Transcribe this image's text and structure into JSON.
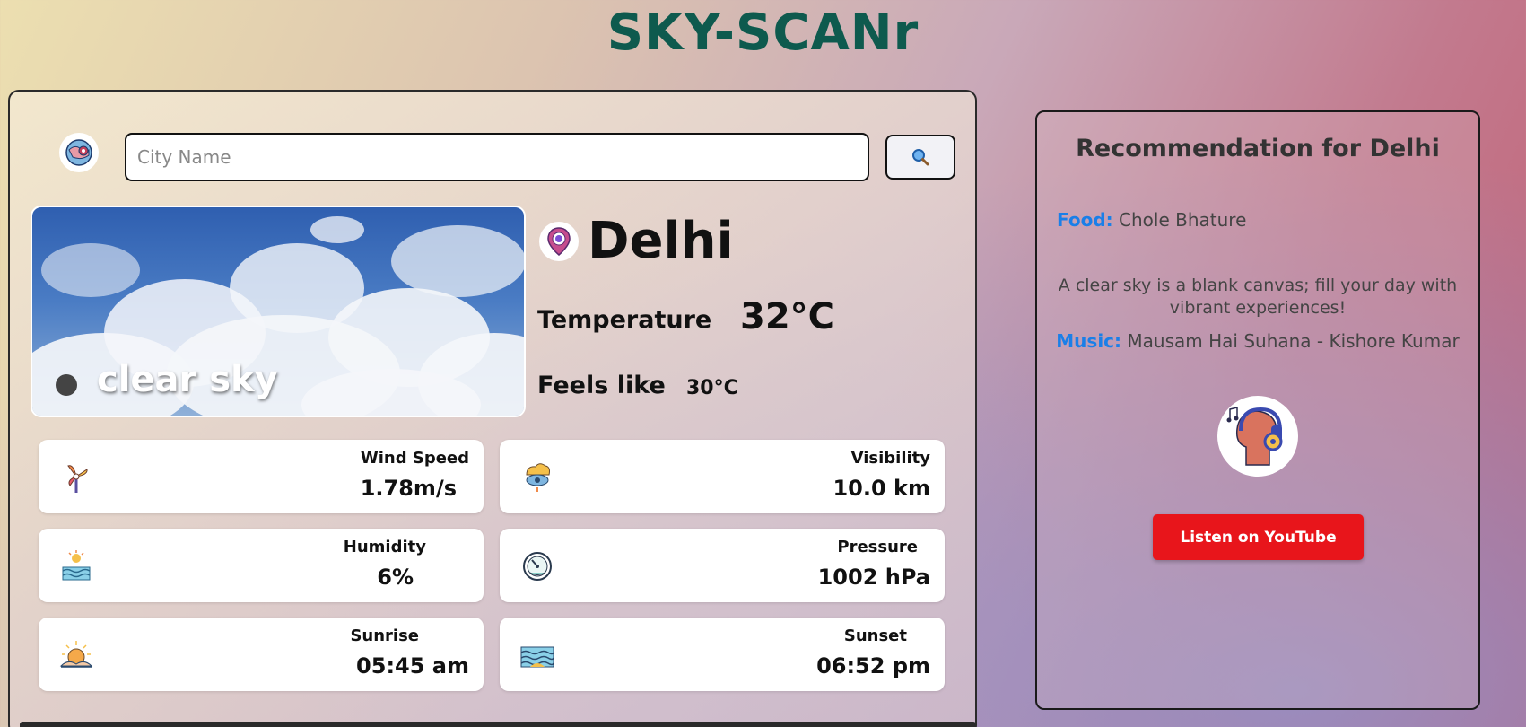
{
  "app": {
    "title": "SKY-SCANr"
  },
  "search": {
    "placeholder": "City Name",
    "value": ""
  },
  "current": {
    "description": "clear sky",
    "city": "Delhi",
    "temperature_label": "Temperature",
    "temperature_value": "32°C",
    "feels_like_label": "Feels like",
    "feels_like_value": "30°C"
  },
  "stats": [
    {
      "label": "Wind Speed",
      "value": "1.78m/s",
      "icon": "wind-icon"
    },
    {
      "label": "Visibility",
      "value": "10.0 km",
      "icon": "visibility-icon"
    },
    {
      "label": "Humidity",
      "value": "6%",
      "icon": "humidity-icon"
    },
    {
      "label": "Pressure",
      "value": "1002 hPa",
      "icon": "pressure-icon"
    },
    {
      "label": "Sunrise",
      "value": "05:45 am",
      "icon": "sunrise-icon"
    },
    {
      "label": "Sunset",
      "value": "06:52 pm",
      "icon": "sunset-icon"
    }
  ],
  "recommendation": {
    "title": "Recommendation for Delhi",
    "food_label": "Food:",
    "food_value": "Chole Bhature",
    "quote": "A clear sky is a blank canvas; fill your day with vibrant experiences!",
    "music_label": "Music:",
    "music_value": "Mausam Hai Suhana - Kishore Kumar",
    "button_label": "Listen on YouTube"
  },
  "colors": {
    "title": "#0e5a4e",
    "accent": "#1a7fe8",
    "youtube": "#e8151b"
  }
}
